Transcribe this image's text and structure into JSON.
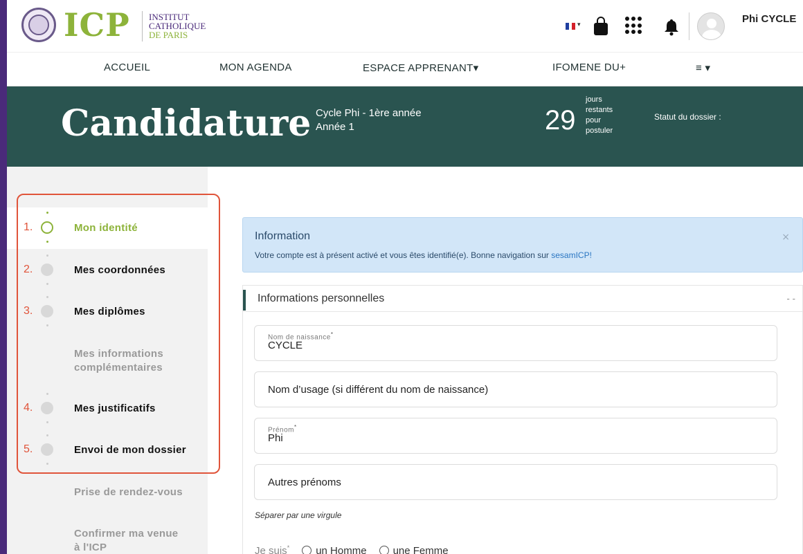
{
  "brand": {
    "logo_text": "ICP",
    "name_line1": "INSTITUT",
    "name_line2": "CATHOLIQUE",
    "name_line3": "DE PARIS"
  },
  "user": {
    "name": "Phi CYCLE"
  },
  "nav": {
    "items": [
      {
        "label": "ACCUEIL"
      },
      {
        "label": "MON AGENDA"
      },
      {
        "label": "ESPACE APPRENANT▾"
      },
      {
        "label": "IFOMENE DU+"
      },
      {
        "label": "≡ ▾"
      }
    ]
  },
  "banner": {
    "title": "Candidature",
    "program": "Cycle Phi - 1ère année",
    "year": "Année 1",
    "days_left": "29",
    "days_text_1": "jours",
    "days_text_2": "restants",
    "days_text_3": "pour",
    "days_text_4": "postuler",
    "status_label": "Statut du dossier :"
  },
  "steps": [
    {
      "num": "1.",
      "label": "Mon identité",
      "state": "active"
    },
    {
      "num": "2.",
      "label": "Mes coordonnées",
      "state": "todo"
    },
    {
      "num": "3.",
      "label": "Mes diplômes",
      "state": "todo"
    },
    {
      "num": "",
      "label_line1": "Mes informations",
      "label_line2": "complémentaires",
      "state": "muted"
    },
    {
      "num": "4.",
      "label": "Mes justificatifs",
      "state": "todo"
    },
    {
      "num": "5.",
      "label": "Envoi de mon dossier",
      "state": "todo"
    },
    {
      "num": "",
      "label": "Prise de rendez-vous",
      "state": "muted"
    },
    {
      "num": "",
      "label_line1": "Confirmer ma venue",
      "label_line2": "à l'ICP",
      "state": "muted"
    }
  ],
  "alert": {
    "title": "Information",
    "message": "Votre compte est à présent activé et vous êtes identifié(e). Bonne navigation sur ",
    "link": "sesamICP!",
    "close": "×"
  },
  "panel": {
    "title": "Informations personnelles",
    "collapse": "- -",
    "fields": {
      "birth_name_label": "Nom de naissance",
      "birth_name_value": "CYCLE",
      "usage_name_placeholder": "Nom d’usage (si différent du nom de naissance)",
      "first_name_label": "Prénom",
      "first_name_value": "Phi",
      "other_names_placeholder": "Autres prénoms"
    },
    "hint": "Séparer par une virgule",
    "gender_label": "Je suis",
    "gender_male": "un Homme",
    "gender_female": "une Femme",
    "required_mark": "*"
  },
  "colors": {
    "brand_green": "#8db33a",
    "banner_teal": "#2a5450",
    "highlight_red": "#e0543a",
    "alert_blue": "#d2e6f8",
    "outer_purple": "#4a2a7a"
  }
}
